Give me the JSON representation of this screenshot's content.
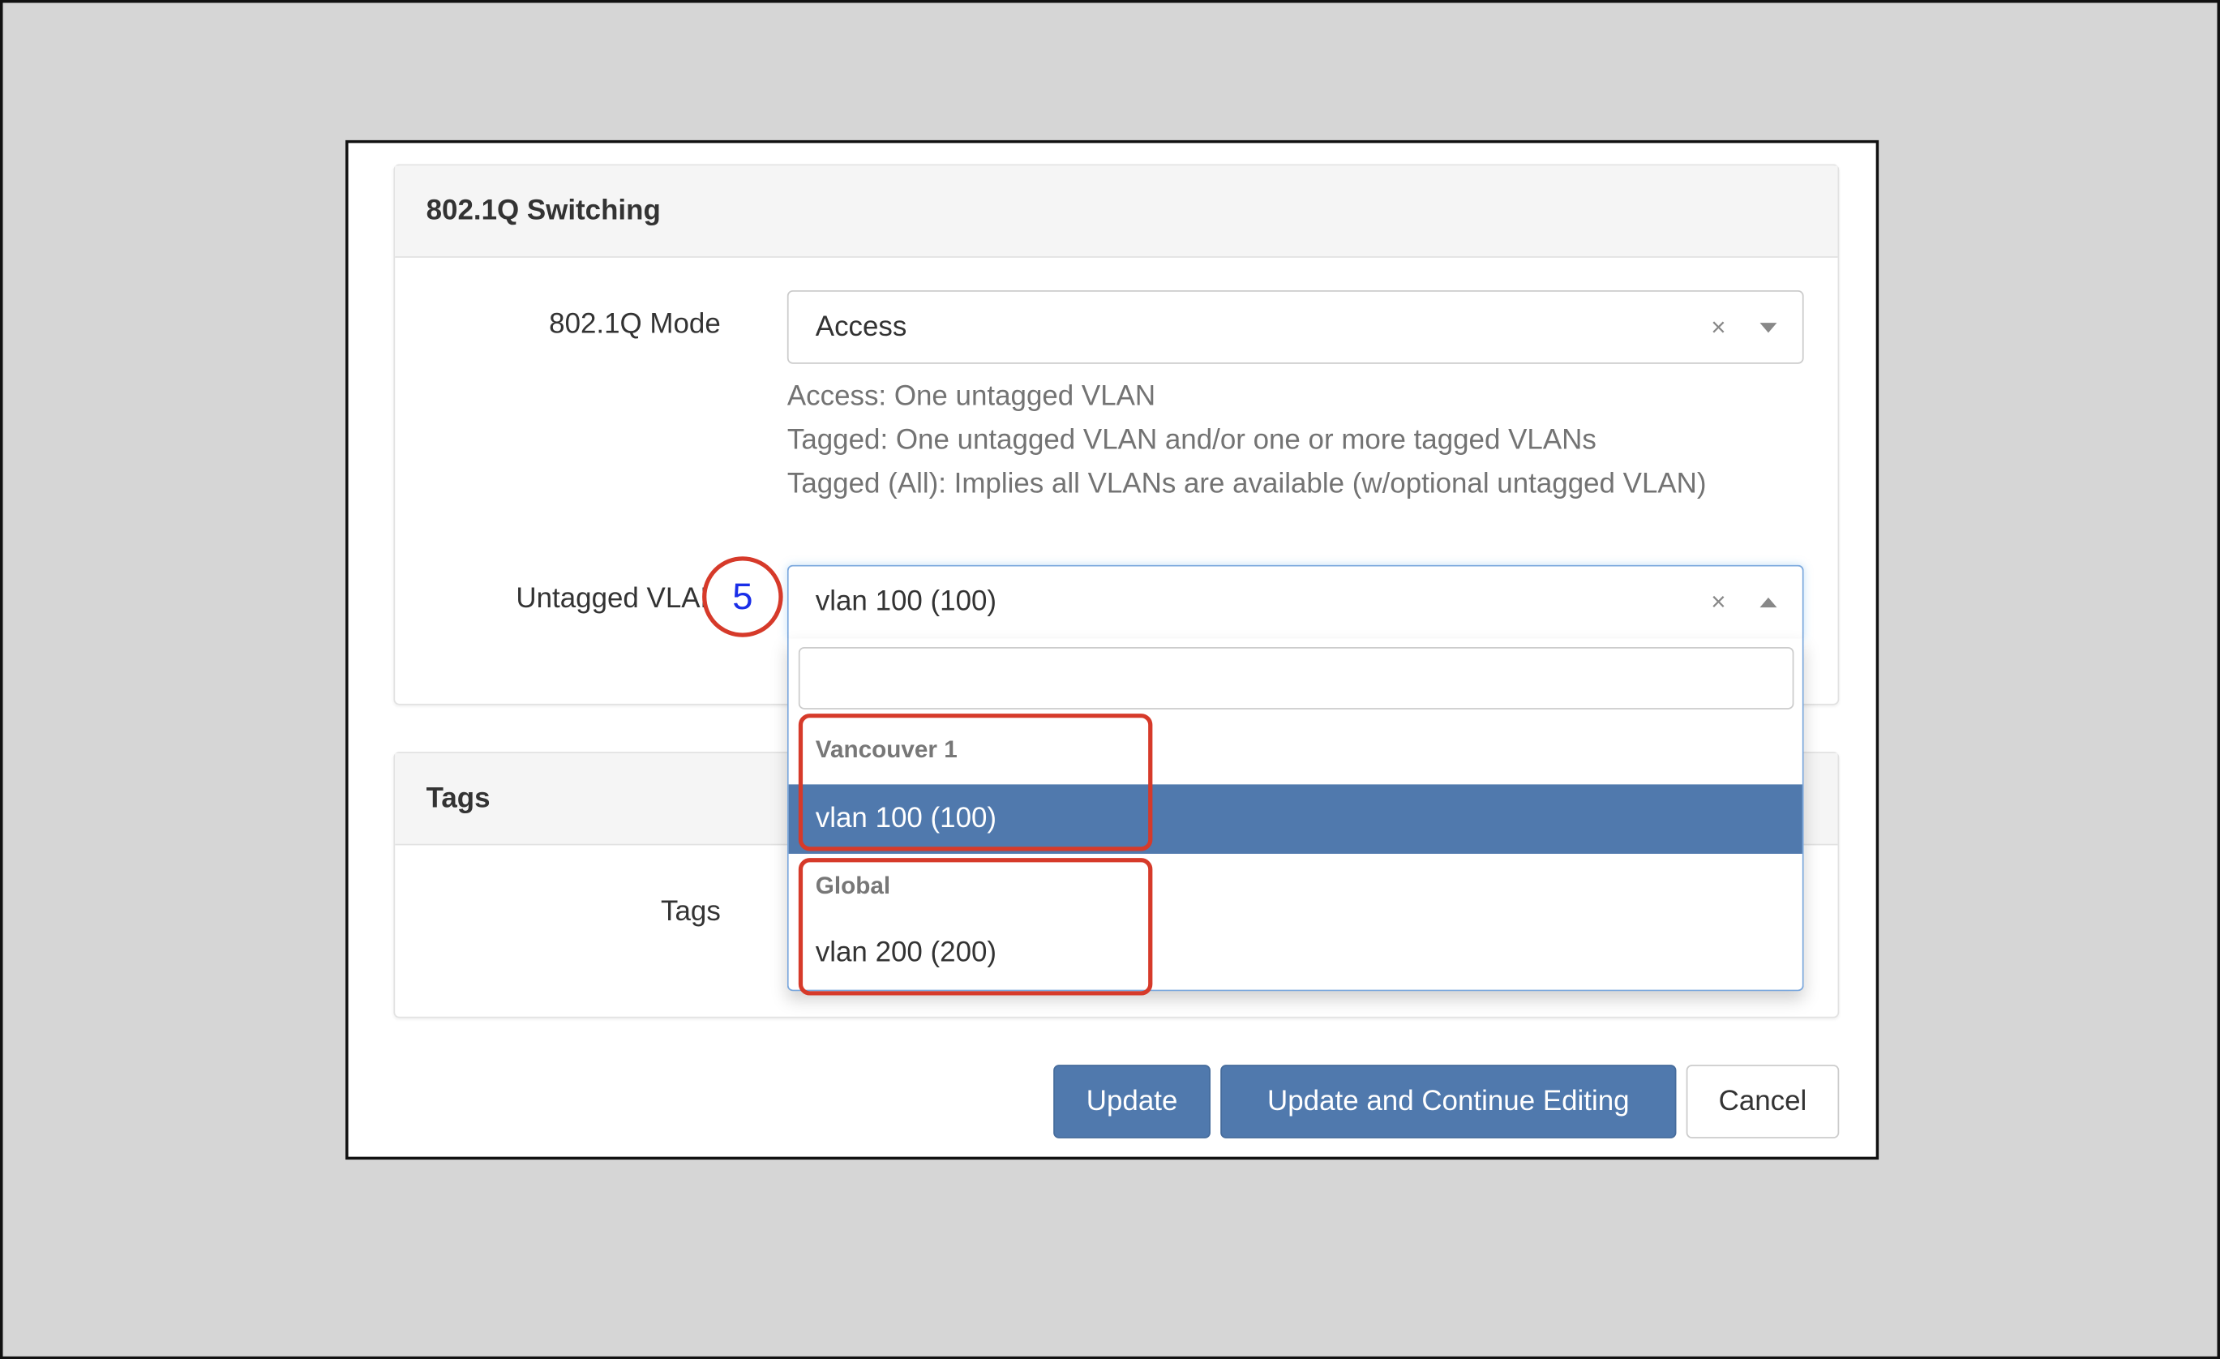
{
  "switching_panel": {
    "title": "802.1Q Switching",
    "mode_label": "802.1Q Mode",
    "mode_value": "Access",
    "help_lines": [
      "Access: One untagged VLAN",
      "Tagged: One untagged VLAN and/or one or more tagged VLANs",
      "Tagged (All): Implies all VLANs are available (w/optional untagged VLAN)"
    ],
    "untagged_label": "Untagged VLAN",
    "untagged_value": "vlan 100 (100)",
    "clear_glyph": "×",
    "search_value": "",
    "dropdown": {
      "groups": [
        {
          "label": "Vancouver 1",
          "options": [
            {
              "label": "vlan 100 (100)",
              "highlighted": true
            }
          ]
        },
        {
          "label": "Global",
          "options": [
            {
              "label": "vlan 200 (200)",
              "highlighted": false
            }
          ]
        }
      ]
    }
  },
  "tags_panel": {
    "title": "Tags",
    "tags_label": "Tags"
  },
  "annotation": {
    "step": "5",
    "circle_color": "#d63a2a",
    "number_color": "#1a2ee8"
  },
  "buttons": {
    "update": "Update",
    "update_continue": "Update and Continue Editing",
    "cancel": "Cancel"
  },
  "colors": {
    "primary": "#5079ad",
    "highlight": "#5079ad",
    "annotation_red": "#d63a2a",
    "focus_border": "#7aa7dd"
  }
}
